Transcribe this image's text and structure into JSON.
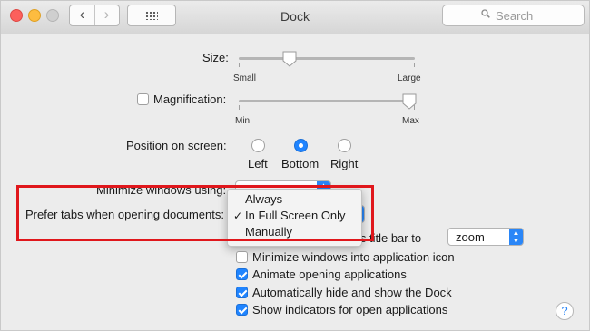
{
  "window": {
    "title": "Dock",
    "search_placeholder": "Search",
    "nav_back": "‹",
    "nav_forward": "›"
  },
  "size": {
    "label": "Size:",
    "min_label": "Small",
    "max_label": "Large",
    "level": 0.28
  },
  "magnification": {
    "label": "Magnification:",
    "checked": false,
    "min_label": "Min",
    "max_label": "Max",
    "level": 0.97
  },
  "position": {
    "label": "Position on screen:",
    "options": [
      {
        "label": "Left",
        "selected": false
      },
      {
        "label": "Bottom",
        "selected": true
      },
      {
        "label": "Right",
        "selected": false
      }
    ]
  },
  "minimize": {
    "label": "Minimize windows using:"
  },
  "prefer_tabs": {
    "label": "Prefer tabs when opening documents:",
    "menu_items": [
      {
        "label": "Always",
        "checked": false
      },
      {
        "label": "In Full Screen Only",
        "checked": true
      },
      {
        "label": "Manually",
        "checked": false
      }
    ],
    "check_glyph": "✓"
  },
  "double_click": {
    "label_visible_part": "w's title bar to",
    "value": "zoom"
  },
  "checkboxes": [
    {
      "label": "Minimize windows into application icon",
      "checked": false
    },
    {
      "label": "Animate opening applications",
      "checked": true
    },
    {
      "label": "Automatically hide and show the Dock",
      "checked": true
    },
    {
      "label": "Show indicators for open applications",
      "checked": true
    }
  ],
  "help": {
    "label": "?"
  },
  "colors": {
    "accent": "#1f84ff",
    "highlight_border": "#e0171c"
  }
}
